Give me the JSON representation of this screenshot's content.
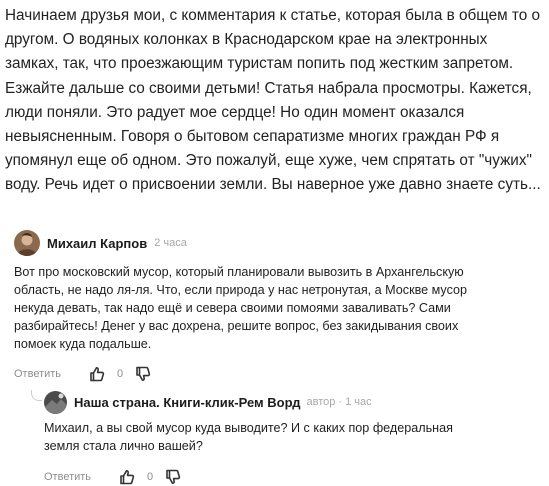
{
  "article": {
    "text": "Начинаем друзья мои, с комментария к статье, которая была в общем то о\nдругом. О водяных колонках в Краснодарском крае на электронных\nзамках, так, что проезжающим туристам попить под жестким запретом.\nЕзжайте дальше со своими детьми! Статья набрала просмотры. Кажется,\nлюди поняли. Это радует мое сердце! Но один момент оказался\nневыясненным. Говоря о бытовом сепаратизме многих граждан РФ я\nупомянул еще об одном. Это пожалуй, еще хуже, чем спрятать от \"чужих\"\nводу. Речь идет о присвоении земли. Вы наверное уже давно знаете суть..."
  },
  "comments": [
    {
      "author": "Михаил Карпов",
      "meta": "2 часа",
      "text": "Вот про московский мусор, который планировали вывозить в Архангельскую\nобласть, не надо ля-ля. Что, если природа у нас нетронутая, а Москве мусор\nнекуда девать, так надо ещё и севера своими помоями заваливать? Сами\nразбирайтесь! Денег у вас дохрена, решите вопрос, без закидывания своих\nпомоек куда подальше.",
      "reply_label": "Ответить",
      "likes": "0"
    },
    {
      "author": "Наша страна. Книги-клик-Рем Ворд",
      "meta": "автор · 1 час",
      "text": "Михаил, а вы свой мусор куда выводите? И с каких пор федеральная\nземля стала лично вашей?",
      "reply_label": "Ответить",
      "likes": "0"
    }
  ],
  "colors": {
    "text": "#1f1f1f",
    "muted": "#8d8d8d",
    "meta": "#a8a8a8"
  },
  "icons": {
    "like": "thumb-up-icon",
    "dislike": "thumb-down-icon",
    "reply_thread": "reply-thread-icon"
  }
}
